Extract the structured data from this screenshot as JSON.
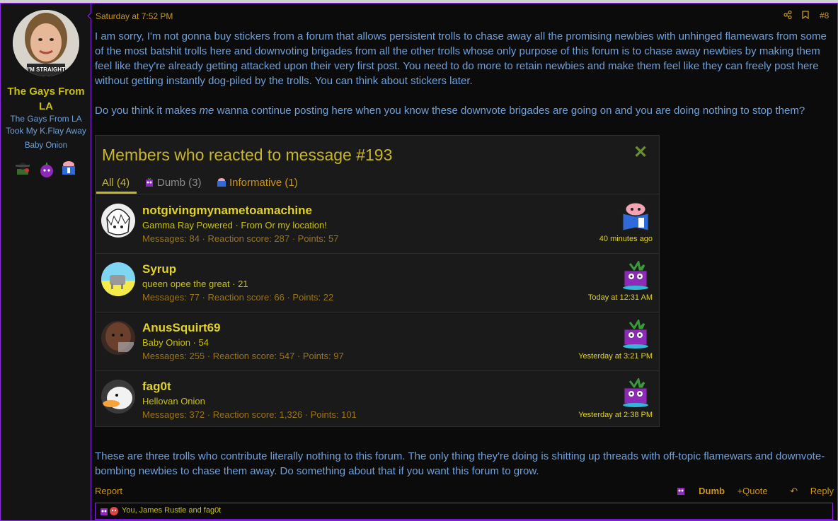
{
  "author": {
    "name": "The Gays From LA",
    "title_line1": "The Gays From LA",
    "title_line2": "Took My K.Flay Away",
    "banner": "Baby Onion",
    "avatar_caption": "I'M STRAIGHT",
    "badges": [
      "trophy-figure-icon",
      "onion-icon",
      "informative-brain-icon"
    ]
  },
  "post": {
    "timestamp": "Saturday at 7:52 PM",
    "number": "#8",
    "paragraph1": "I am sorry, I'm not gonna buy stickers from a forum that allows persistent trolls to chase away all the promising newbies with unhinged flamewars from some of the most batshit trolls here and downvoting brigades from all the other trolls whose only purpose of this forum is to chase away newbies by making them feel like they're already getting attacked upon their very first post. You need to do more to retain newbies and make them feel like they can freely post here without getting instantly dog-piled by the trolls. You can think about stickers later.",
    "p2_before": "Do you think it makes ",
    "p2_em": "me",
    "p2_after": " wanna continue posting here when you know these downvote brigades are going on and you are doing nothing to stop them?",
    "paragraph3": "These are three trolls who contribute literally nothing to this forum. The only thing they're doing is shitting up threads with off-topic flamewars and downvote-bombing newbies to chase them away. Do something about that if you want this forum to grow."
  },
  "reactions_panel": {
    "title": "Members who reacted to message #193",
    "tabs": [
      {
        "label": "All (4)",
        "active": true
      },
      {
        "label": "Dumb (3)",
        "icon": "dumb-icon"
      },
      {
        "label": "Informative (1)",
        "icon": "informative-icon"
      }
    ],
    "rows": [
      {
        "name": "notgivingmynametoamachine",
        "subtitle": "Gamma Ray Powered · From Or my location!",
        "stats": "Messages: 84 · Reaction score: 287 · Points: 57",
        "reaction": "informative-icon",
        "time": "40 minutes ago"
      },
      {
        "name": "Syrup",
        "subtitle": "queen opee the great · 21",
        "stats": "Messages: 77 · Reaction score: 66 · Points: 22",
        "reaction": "dumb-icon",
        "time": "Today at 12:31 AM"
      },
      {
        "name": "AnusSquirt69",
        "subtitle": "Baby Onion · 54",
        "stats": "Messages: 255 · Reaction score: 547 · Points: 97",
        "reaction": "dumb-icon",
        "time": "Yesterday at 3:21 PM"
      },
      {
        "name": "fag0t",
        "subtitle": "Hellovan Onion",
        "stats": "Messages: 372 · Reaction score: 1,326 · Points: 101",
        "reaction": "dumb-icon",
        "time": "Yesterday at 2:38 PM"
      }
    ]
  },
  "footer": {
    "report": "Report",
    "dumb": "Dumb",
    "quote": "+Quote",
    "reply": "Reply"
  },
  "reaction_summary": "You, James Rustle and fag0t",
  "colors": {
    "accent_purple": "#8a2be2",
    "gold": "#c8b62a",
    "link_blue": "#6fa0d8"
  }
}
